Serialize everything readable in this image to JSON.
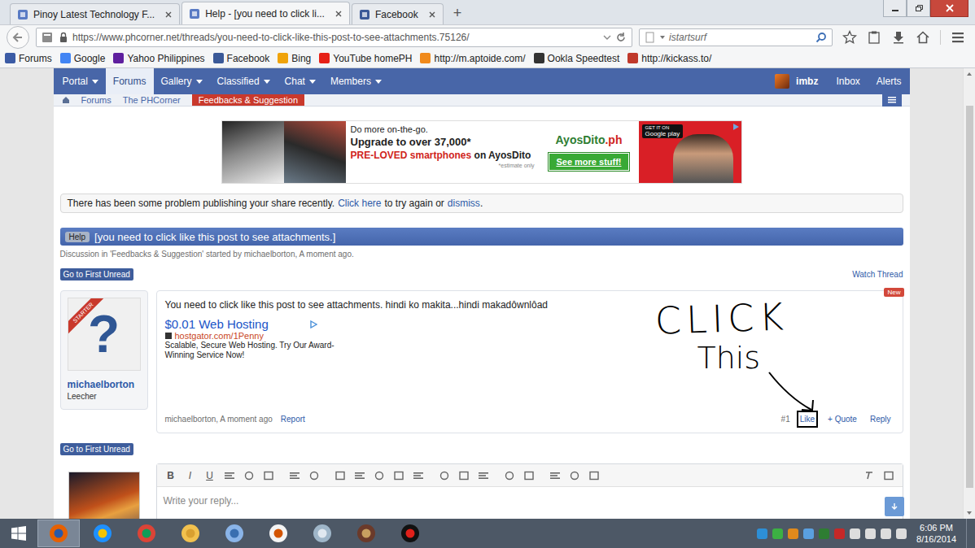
{
  "browser": {
    "tabs": [
      {
        "label": "Pinoy Latest Technology F...",
        "selected": false
      },
      {
        "label": "Help - [you need to click li...",
        "selected": true
      },
      {
        "label": "Facebook",
        "selected": false
      }
    ],
    "new_tab": "+",
    "url": "https://www.phcorner.net/threads/you-need-to-click-like-this-post-to-see-attachments.75126/",
    "search": "istartsurf",
    "bookmarks": [
      {
        "label": "Forums",
        "color": "#3b5ba5"
      },
      {
        "label": "Google",
        "color": "#4285f4"
      },
      {
        "label": "Yahoo Philippines",
        "color": "#5f1f9e"
      },
      {
        "label": "Facebook",
        "color": "#3b5998"
      },
      {
        "label": "Bing",
        "color": "#f0a30a"
      },
      {
        "label": "YouTube homePH",
        "color": "#e62117"
      },
      {
        "label": "http://m.aptoide.com/",
        "color": "#f08a1c"
      },
      {
        "label": "Ookla Speedtest",
        "color": "#333333"
      },
      {
        "label": "http://kickass.to/",
        "color": "#c0392b"
      }
    ]
  },
  "site": {
    "nav": [
      {
        "label": "Portal",
        "selected": false,
        "menu": true
      },
      {
        "label": "Forums",
        "selected": true,
        "menu": false
      },
      {
        "label": "Gallery",
        "selected": false,
        "menu": true
      },
      {
        "label": "Classified",
        "selected": false,
        "menu": true
      },
      {
        "label": "Chat",
        "selected": false,
        "menu": true
      },
      {
        "label": "Members",
        "selected": false,
        "menu": true
      }
    ],
    "user": "imbz",
    "nav_links": [
      "Inbox",
      "Alerts"
    ],
    "breadcrumbs": [
      {
        "label": "Forums",
        "current": false
      },
      {
        "label": "The PHCorner",
        "current": false
      },
      {
        "label": "Feedbacks & Suggestion",
        "current": true
      }
    ]
  },
  "ad_banner": {
    "line1": "Do more on-the-go.",
    "line2": "Upgrade to over 37,000*",
    "line3_red": "PRE-LOVED smartphones",
    "line3_rest": "on AyosDito",
    "footnote": "*estimate only",
    "logo": "AyosDito",
    "logo_suffix": ".ph",
    "button": "See more stuff!",
    "store_small": "GET IT ON",
    "store": "Google play"
  },
  "notice": {
    "text": "There has been some problem publishing your share recently.",
    "link": "Click here",
    "middle": "to try again or",
    "dismiss": "dismiss",
    "end": "."
  },
  "thread": {
    "prefix": "Help",
    "title": "[you need to click like this post to see attachments.]",
    "meta": "Discussion in 'Feedbacks & Suggestion' started by michaelborton, A moment ago.",
    "first_unread": "Go to First Unread",
    "watch": "Watch Thread"
  },
  "post": {
    "ribbon": "STARTER",
    "avatar": "?",
    "author": "michaelborton",
    "rank": "Leecher",
    "badge": "New",
    "body": "You need to click like this post to see attachments. hindi ko makita...hindi makadôwnlôad",
    "ad": {
      "title": "$0.01 Web Hosting",
      "url": "hostgator.com/1Penny",
      "text": "Scalable, Secure Web Hosting. Try Our Award-Winning Service Now!"
    },
    "annotation": {
      "line1": "CLICK",
      "line2": "This"
    },
    "byline": "michaelborton, A moment ago",
    "report": "Report",
    "number": "#1",
    "actions": [
      {
        "label": "Like",
        "highlighted": true
      },
      {
        "label": "+ Quote",
        "highlighted": false
      },
      {
        "label": "Reply",
        "highlighted": false
      }
    ]
  },
  "editor": {
    "buttons": [
      "B",
      "I",
      "U"
    ],
    "placeholder": "Write your reply..."
  },
  "taskbar": {
    "time": "6:06 PM",
    "date": "8/16/2014"
  }
}
